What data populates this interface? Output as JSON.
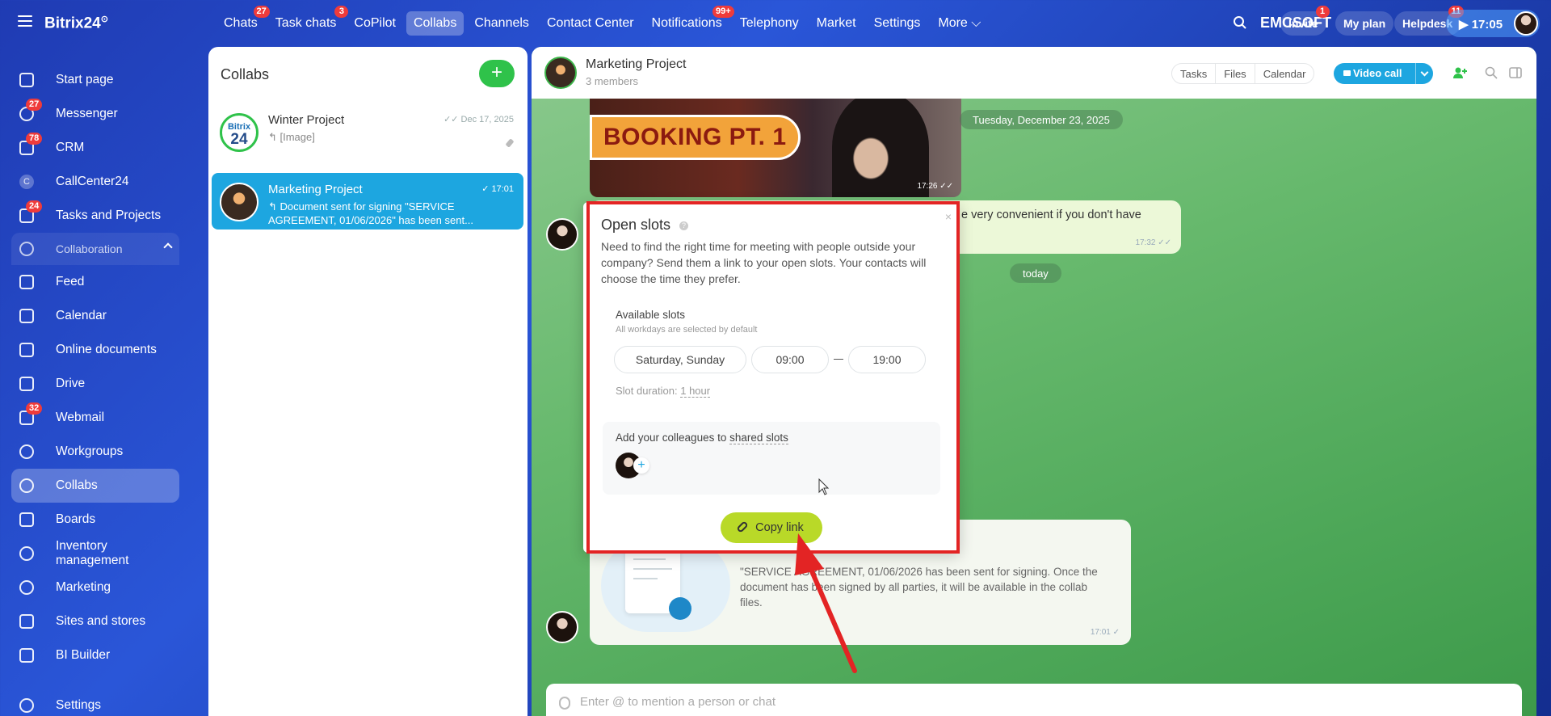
{
  "app": {
    "brand": "Bitrix24",
    "brand_mark": "⊙"
  },
  "topnav": [
    {
      "label": "Chats",
      "badge": "27"
    },
    {
      "label": "Task chats",
      "badge": "3"
    },
    {
      "label": "CoPilot",
      "badge": ""
    },
    {
      "label": "Collabs",
      "badge": "",
      "active": true
    },
    {
      "label": "Channels",
      "badge": ""
    },
    {
      "label": "Contact Center",
      "badge": ""
    },
    {
      "label": "Notifications",
      "badge": "99+"
    },
    {
      "label": "Telephony",
      "badge": ""
    },
    {
      "label": "Market",
      "badge": ""
    },
    {
      "label": "Settings",
      "badge": ""
    },
    {
      "label": "More ⌵",
      "badge": ""
    }
  ],
  "topright": {
    "company": "EMCSOFT",
    "invite": "Invite",
    "invite_badge": "1",
    "myplan": "My plan",
    "helpdesk": "Helpdesk",
    "helpdesk_badge": "11",
    "clock": "▶ 17:05"
  },
  "sidebar": {
    "items": [
      {
        "label": "Start page",
        "badge": ""
      },
      {
        "label": "Messenger",
        "badge": "27"
      },
      {
        "label": "CRM",
        "badge": "78"
      },
      {
        "label": "CallCenter24",
        "badge": ""
      },
      {
        "label": "Tasks and Projects",
        "badge": "24"
      }
    ],
    "group_label": "Collaboration",
    "group_items": [
      {
        "label": "Feed",
        "badge": ""
      },
      {
        "label": "Calendar",
        "badge": ""
      },
      {
        "label": "Online documents",
        "badge": ""
      },
      {
        "label": "Drive",
        "badge": ""
      },
      {
        "label": "Webmail",
        "badge": "32"
      },
      {
        "label": "Workgroups",
        "badge": ""
      },
      {
        "label": "Collabs",
        "badge": ""
      },
      {
        "label": "Boards",
        "badge": ""
      },
      {
        "label": "Inventory management",
        "badge": ""
      },
      {
        "label": "Marketing",
        "badge": ""
      },
      {
        "label": "Sites and stores",
        "badge": ""
      },
      {
        "label": "BI Builder",
        "badge": ""
      }
    ],
    "settings": "Settings",
    "callcenter_letter": "C"
  },
  "collabs": {
    "title": "Collabs",
    "add": "+",
    "chats": [
      {
        "name": "Winter Project",
        "preview": "↰ [Image]",
        "time": "✓✓ Dec 17, 2025",
        "logo_top": "Bitrix",
        "logo_num": "24"
      },
      {
        "name": "Marketing Project",
        "preview": "↰ Document sent for signing \"SERVICE AGREEMENT, 01/06/2026\" has been sent...",
        "time": "✓ 17:01"
      }
    ]
  },
  "chat": {
    "title": "Marketing Project",
    "members": "3 members",
    "buttons": [
      "Tasks",
      "Files",
      "Calendar"
    ],
    "video_call": "Video call",
    "booking_text": "BOOKING PT. 1",
    "booking_time": "17:26 ✓✓",
    "date_divider": "Tuesday, December 23, 2025",
    "msg_fragment": "e very convenient if you don't have",
    "msg_time": "17:32 ✓✓",
    "today": "today",
    "doc_text": "\"SERVICE AGREEMENT, 01/06/2026 has been sent for signing. Once the document has been signed by all parties, it will be available in the collab files.",
    "doc_time": "17:01 ✓",
    "input_placeholder": "Enter @ to mention a person or chat"
  },
  "popup": {
    "title": "Open slots",
    "help": "?",
    "close": "×",
    "description": "Need to find the right time for meeting with people outside your company? Send them a link to your open slots. Your contacts will choose the time they prefer.",
    "available_label": "Available slots",
    "available_sub": "All workdays are selected by default",
    "days": "Saturday, Sunday",
    "from": "09:00",
    "to": "19:00",
    "duration_label": "Slot duration:",
    "duration_value": "1 hour",
    "colleagues_label": "Add your colleagues to",
    "colleagues_link": "shared slots",
    "add_colleague": "+",
    "copy_link": "Copy link"
  },
  "colors": {
    "accent_green": "#2fc24a",
    "accent_blue": "#1da6e0",
    "annotation_red": "#e32424",
    "copy_button": "#b9d928"
  }
}
